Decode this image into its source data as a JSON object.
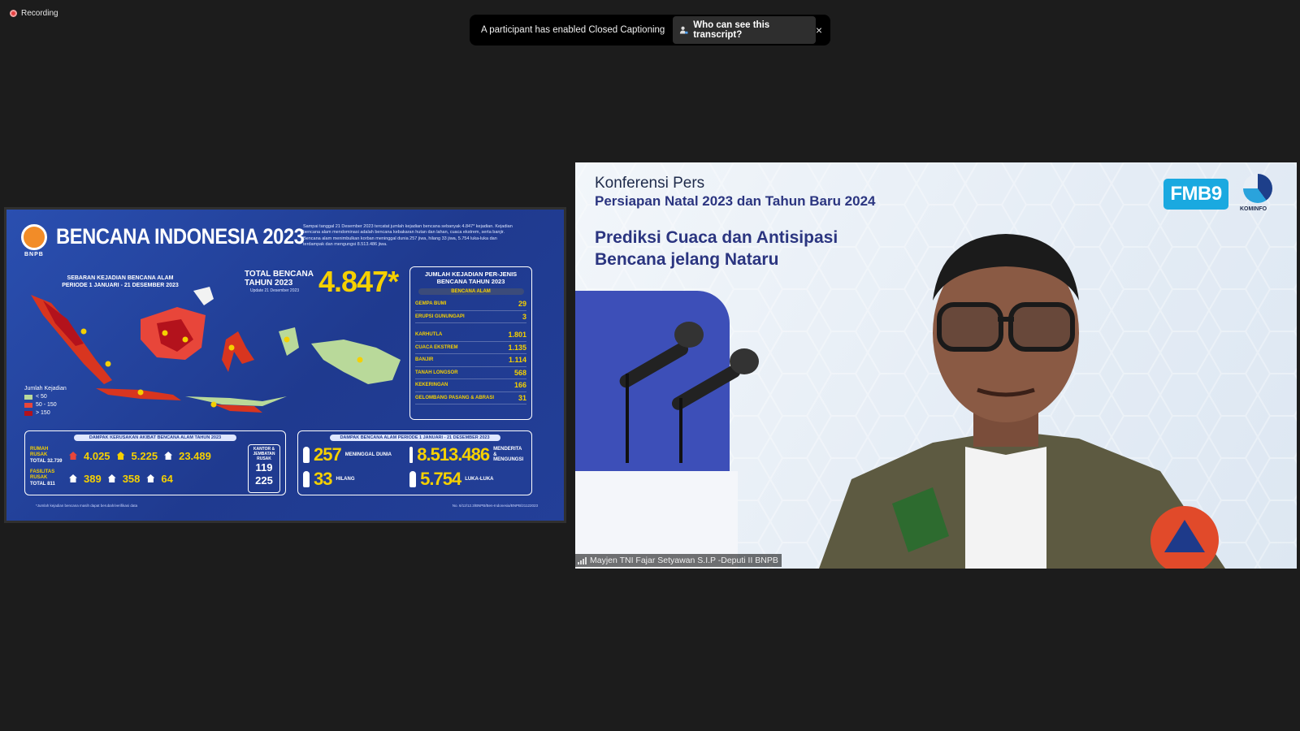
{
  "recording": {
    "label": "Recording"
  },
  "cc_banner": {
    "message": "A participant has enabled Closed Captioning",
    "button_label": "Who can see this transcript?",
    "close_glyph": "×"
  },
  "slide": {
    "org": "BNPB",
    "title": "BENCANA INDONESIA 2023",
    "description": "Sampai tanggal 21 Desember 2023 tercatat jumlah kejadian bencana sebanyak 4.847* kejadian. Kejadian bencana alam mendominasi adalah bencana kebakaran hutan dan lahan, cuaca ekstrem, serta banjir. Bencana alam menimbulkan korban meninggal dunia 257 jiwa, hilang 33 jiwa, 5.754 luka-luka dan terdampak dan mengungsi 8.513.486 jiwa.",
    "map_title_1": "SEBARAN KEJADIAN BENCANA ALAM",
    "map_title_2": "PERIODE 1 JANUARI - 21 DESEMBER 2023",
    "legend_title": "Jumlah Kejadian",
    "legend": [
      {
        "label": "< 50",
        "color": "#b9d99a"
      },
      {
        "label": "50 - 150",
        "color": "#e8463a"
      },
      {
        "label": "> 150",
        "color": "#b3121c"
      }
    ],
    "total_label_1": "TOTAL BENCANA",
    "total_label_2": "TAHUN 2023",
    "total_update": "Update 21 Desember 2023",
    "total_value": "4.847*",
    "types_header_1": "JUMLAH KEJADIAN PER-JENIS",
    "types_header_2": "BENCANA TAHUN 2023",
    "types_pill": "BENCANA ALAM",
    "types_group1": [
      {
        "name": "GEMPA BUMI",
        "value": "29"
      },
      {
        "name": "ERUPSI GUNUNGAPI",
        "value": "3"
      }
    ],
    "types_group2": [
      {
        "name": "KARHUTLA",
        "value": "1.801"
      },
      {
        "name": "CUACA EKSTREM",
        "value": "1.135"
      },
      {
        "name": "BANJIR",
        "value": "1.114"
      },
      {
        "name": "TANAH LONGSOR",
        "value": "568"
      },
      {
        "name": "KEKERINGAN",
        "value": "166"
      },
      {
        "name": "GELOMBANG PASANG & ABRASI",
        "value": "31"
      }
    ],
    "damage_header": "DAMPAK KERUSAKAN AKIBAT BENCANA ALAM TAHUN 2023",
    "damage_row1": {
      "label": "RUMAH RUSAK",
      "total_label": "TOTAL",
      "total": "32.739",
      "v1": "4.025",
      "v2": "5.225",
      "v3": "23.489"
    },
    "damage_row2": {
      "label": "FASILITAS RUSAK",
      "total_label": "TOTAL",
      "total": "811",
      "v1": "389",
      "v2": "358",
      "v3": "64"
    },
    "kantor_label": "KANTOR & JEMBATAN RUSAK",
    "kantor_value": "119",
    "jembatan_value": "225",
    "impact_header": "DAMPAK BENCANA ALAM PERIODE 1 JANUARI - 21 DESEMBER 2023",
    "impact": [
      {
        "value": "257",
        "label": "MENINGGAL DUNIA"
      },
      {
        "value": "8.513.486",
        "label": "MENDERITA & MENGUNGSI"
      },
      {
        "value": "33",
        "label": "HILANG"
      },
      {
        "value": "5.754",
        "label": "LUKA-LUKA"
      }
    ],
    "footnote": "*Jumlah kejadian bencana masih dapat berubah/verifikasi data",
    "doc_no": "No. 6/12/12.3/BNPB/Ben-Indonesia/BNPB/21122023"
  },
  "video": {
    "title_1": "Konferensi Pers",
    "title_2": "Persiapan Natal 2023 dan Tahun Baru 2024",
    "title_3a": "Prediksi Cuaca dan Antisipasi",
    "title_3b": "Bencana jelang Nataru",
    "fmb_logo": "FMB9",
    "kominfo_label": "KOMINFO",
    "participant_name": "Mayjen TNI Fajar Setyawan S.I.P -Deputi II BNPB"
  }
}
